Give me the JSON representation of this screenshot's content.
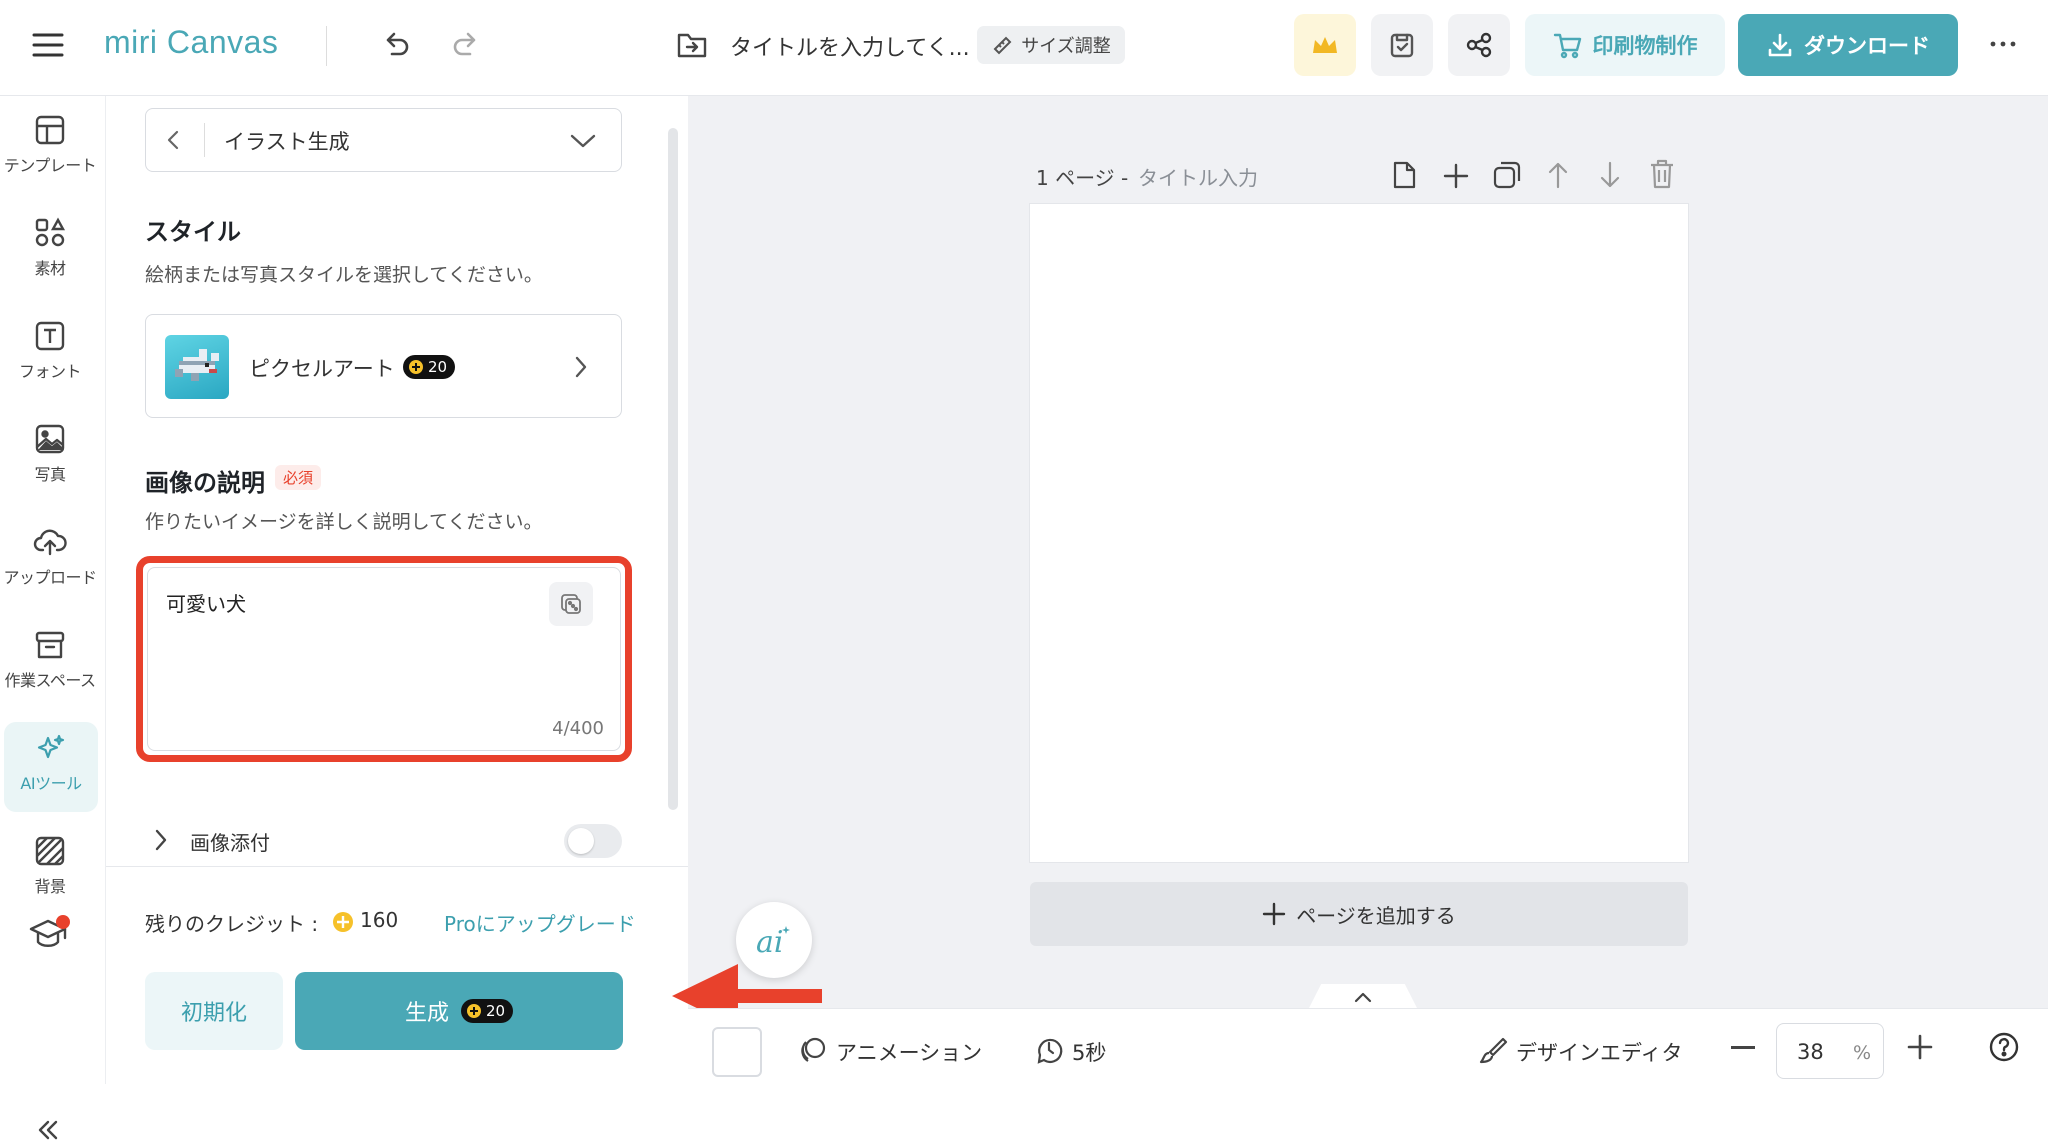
{
  "header": {
    "logo": "miri Canvas",
    "doc_title": "タイトルを入力してく...",
    "resize_label": "サイズ調整",
    "print_label": "印刷物制作",
    "download_label": "ダウンロード"
  },
  "nav": {
    "items": [
      {
        "label": "テンプレート",
        "icon": "template-icon"
      },
      {
        "label": "素材",
        "icon": "shapes-icon"
      },
      {
        "label": "フォント",
        "icon": "text-icon"
      },
      {
        "label": "写真",
        "icon": "photo-icon"
      },
      {
        "label": "アップロード",
        "icon": "upload-icon"
      },
      {
        "label": "作業スペース",
        "icon": "archive-icon"
      },
      {
        "label": "AIツール",
        "icon": "sparkle-icon"
      },
      {
        "label": "背景",
        "icon": "background-icon"
      }
    ]
  },
  "panel": {
    "tool_select": "イラスト生成",
    "style": {
      "title": "スタイル",
      "description": "絵柄または写真スタイルを選択してください。",
      "selected": "ピクセルアート",
      "cost": "20"
    },
    "prompt": {
      "title": "画像の説明",
      "required_badge": "必須",
      "description": "作りたいイメージを詳しく説明してください。",
      "value": "可愛い犬",
      "count": "4/400"
    },
    "attach": {
      "label": "画像添付",
      "enabled": false
    },
    "credits": {
      "label": "残りのクレジット :",
      "value": "160",
      "upgrade": "Proにアップグレード"
    },
    "reset_label": "初期化",
    "generate_label": "生成",
    "generate_cost": "20"
  },
  "canvas": {
    "page_number": "1 ページ -",
    "page_title_placeholder": "タイトル入力",
    "add_page": "ページを追加する"
  },
  "bottom": {
    "animation": "アニメーション",
    "duration": "5秒",
    "design_editor": "デザインエディタ",
    "zoom": "38",
    "zoom_unit": "%"
  },
  "colors": {
    "accent": "#4aa8b6",
    "highlight": "#e8412c",
    "crown_bg": "#fdf6da"
  }
}
